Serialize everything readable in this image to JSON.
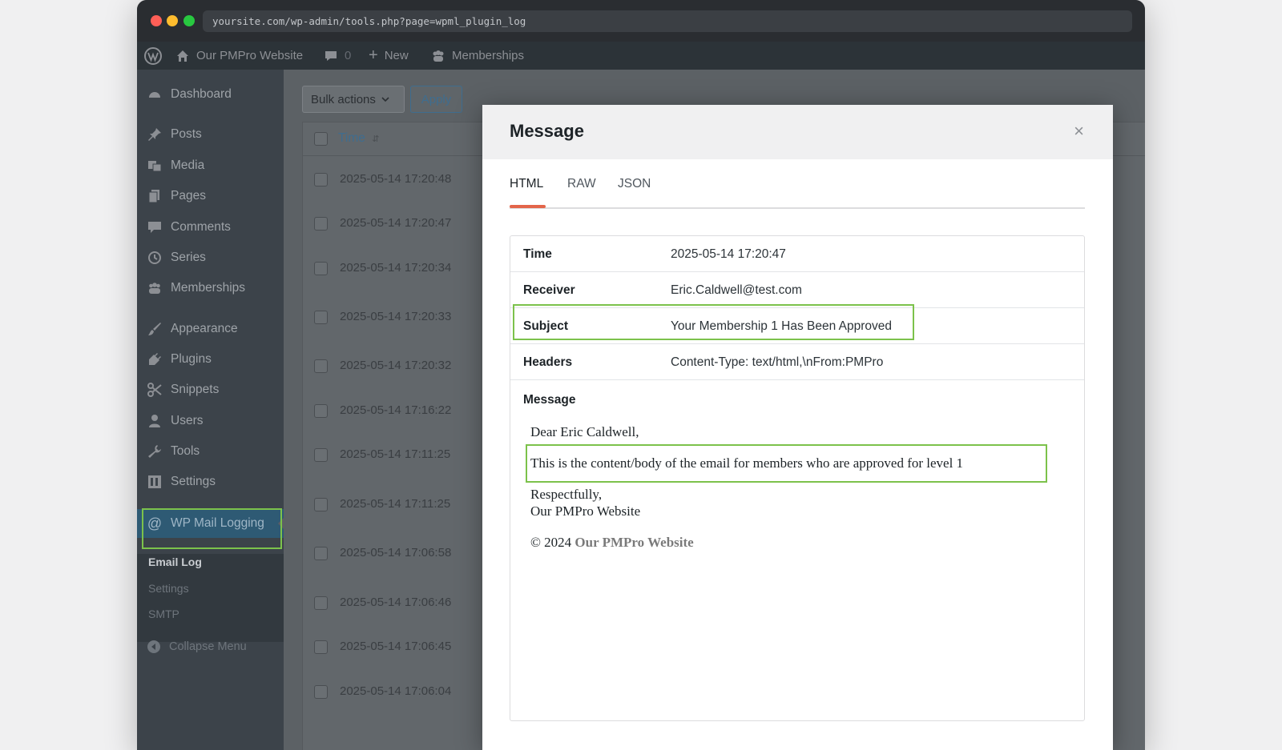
{
  "browser": {
    "url": "yoursite.com/wp-admin/tools.php?page=wpml_plugin_log"
  },
  "adminbar": {
    "site_name": "Our PMPro Website",
    "comments_count": "0",
    "new_label": "New",
    "memberships_label": "Memberships"
  },
  "sidebar": {
    "items": [
      {
        "label": "Dashboard",
        "icon": "dashboard-icon"
      },
      {
        "label": "Posts",
        "icon": "pin-icon"
      },
      {
        "label": "Media",
        "icon": "media-icon"
      },
      {
        "label": "Pages",
        "icon": "pages-icon"
      },
      {
        "label": "Comments",
        "icon": "comment-icon"
      },
      {
        "label": "Series",
        "icon": "clock-icon"
      },
      {
        "label": "Memberships",
        "icon": "groups-icon"
      },
      {
        "label": "Appearance",
        "icon": "brush-icon"
      },
      {
        "label": "Plugins",
        "icon": "plug-icon"
      },
      {
        "label": "Snippets",
        "icon": "scissors-icon"
      },
      {
        "label": "Users",
        "icon": "user-icon"
      },
      {
        "label": "Tools",
        "icon": "wrench-icon"
      },
      {
        "label": "Settings",
        "icon": "settings-icon"
      },
      {
        "label": "WP Mail Logging",
        "icon": "at-icon"
      }
    ],
    "submenu": {
      "email_log": "Email Log",
      "settings": "Settings",
      "smtp": "SMTP"
    },
    "collapse_label": "Collapse Menu"
  },
  "list": {
    "bulk_actions_label": "Bulk actions",
    "apply_label": "Apply",
    "time_header": "Time",
    "rows": [
      "2025-05-14 17:20:48",
      "2025-05-14 17:20:47",
      "2025-05-14 17:20:34",
      "2025-05-14 17:20:33",
      "2025-05-14 17:20:32",
      "2025-05-14 17:16:22",
      "2025-05-14 17:11:25",
      "2025-05-14 17:11:25",
      "2025-05-14 17:06:58",
      "2025-05-14 17:06:46",
      "2025-05-14 17:06:45",
      "2025-05-14 17:06:04"
    ]
  },
  "modal": {
    "title": "Message",
    "close": "×",
    "tabs": [
      "HTML",
      "RAW",
      "JSON"
    ],
    "active_tab": "HTML",
    "details": [
      {
        "label": "Time",
        "value": "2025-05-14 17:20:47"
      },
      {
        "label": "Receiver",
        "value": "Eric.Caldwell@test.com"
      },
      {
        "label": "Subject",
        "value": "Your Membership 1 Has Been Approved"
      },
      {
        "label": "Headers",
        "value": "Content-Type: text/html,\\nFrom:PMPro"
      }
    ],
    "message_label": "Message",
    "email": {
      "greeting": "Dear Eric Caldwell,",
      "body": "This is the content/body of the email for members who are approved for level 1",
      "closing": "Respectfully,",
      "signature": "Our PMPro Website",
      "copyright": "© 2024",
      "footer_link": "Our PMPro Website"
    }
  },
  "colors": {
    "highlight": "#7cc24b",
    "tab_accent": "#e3654a",
    "admin_bar": "#2c3338",
    "sidebar": "#3c434a"
  }
}
